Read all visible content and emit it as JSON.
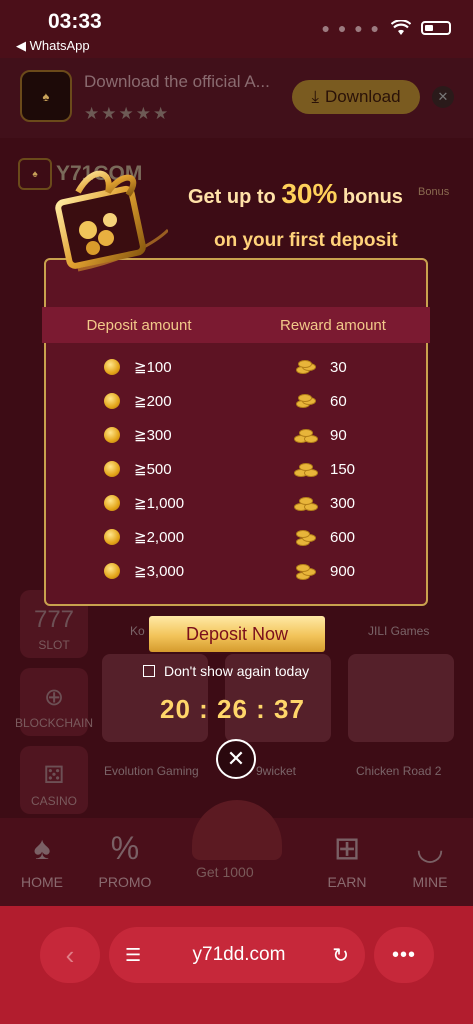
{
  "status_bar": {
    "time": "03:33",
    "back_app": "◀ WhatsApp"
  },
  "download_banner": {
    "title": "Download the official A...",
    "stars": "★★★★★",
    "button_label": "Download"
  },
  "site": {
    "logo_text": "Y71COM",
    "bonus_label": "Bonus"
  },
  "background": {
    "side_nav": [
      "SLOT",
      "BLOCKCHAIN",
      "CASINO"
    ],
    "tiles": [
      "Ko",
      "JILI Games",
      "Evolution Gaming",
      "9wicket",
      "Chicken Road 2"
    ]
  },
  "popup": {
    "headline_prefix": "Get up to ",
    "headline_value": "30%",
    "headline_suffix": " bonus",
    "subline": "on your first deposit",
    "col_deposit": "Deposit amount",
    "col_reward": "Reward amount",
    "rows": [
      {
        "deposit": "≧100",
        "reward": "30"
      },
      {
        "deposit": "≧200",
        "reward": "60"
      },
      {
        "deposit": "≧300",
        "reward": "90"
      },
      {
        "deposit": "≧500",
        "reward": "150"
      },
      {
        "deposit": "≧1,000",
        "reward": "300"
      },
      {
        "deposit": "≧2,000",
        "reward": "600"
      },
      {
        "deposit": "≧3,000",
        "reward": "900"
      }
    ],
    "deposit_button": "Deposit Now",
    "dont_show": "Don't show again today",
    "countdown": "20 : 26 : 37"
  },
  "bottom_nav": {
    "home": "HOME",
    "promo": "PROMO",
    "get": "Get 1000",
    "earn": "EARN",
    "mine": "MINE"
  },
  "browser": {
    "url": "y71dd.com"
  }
}
